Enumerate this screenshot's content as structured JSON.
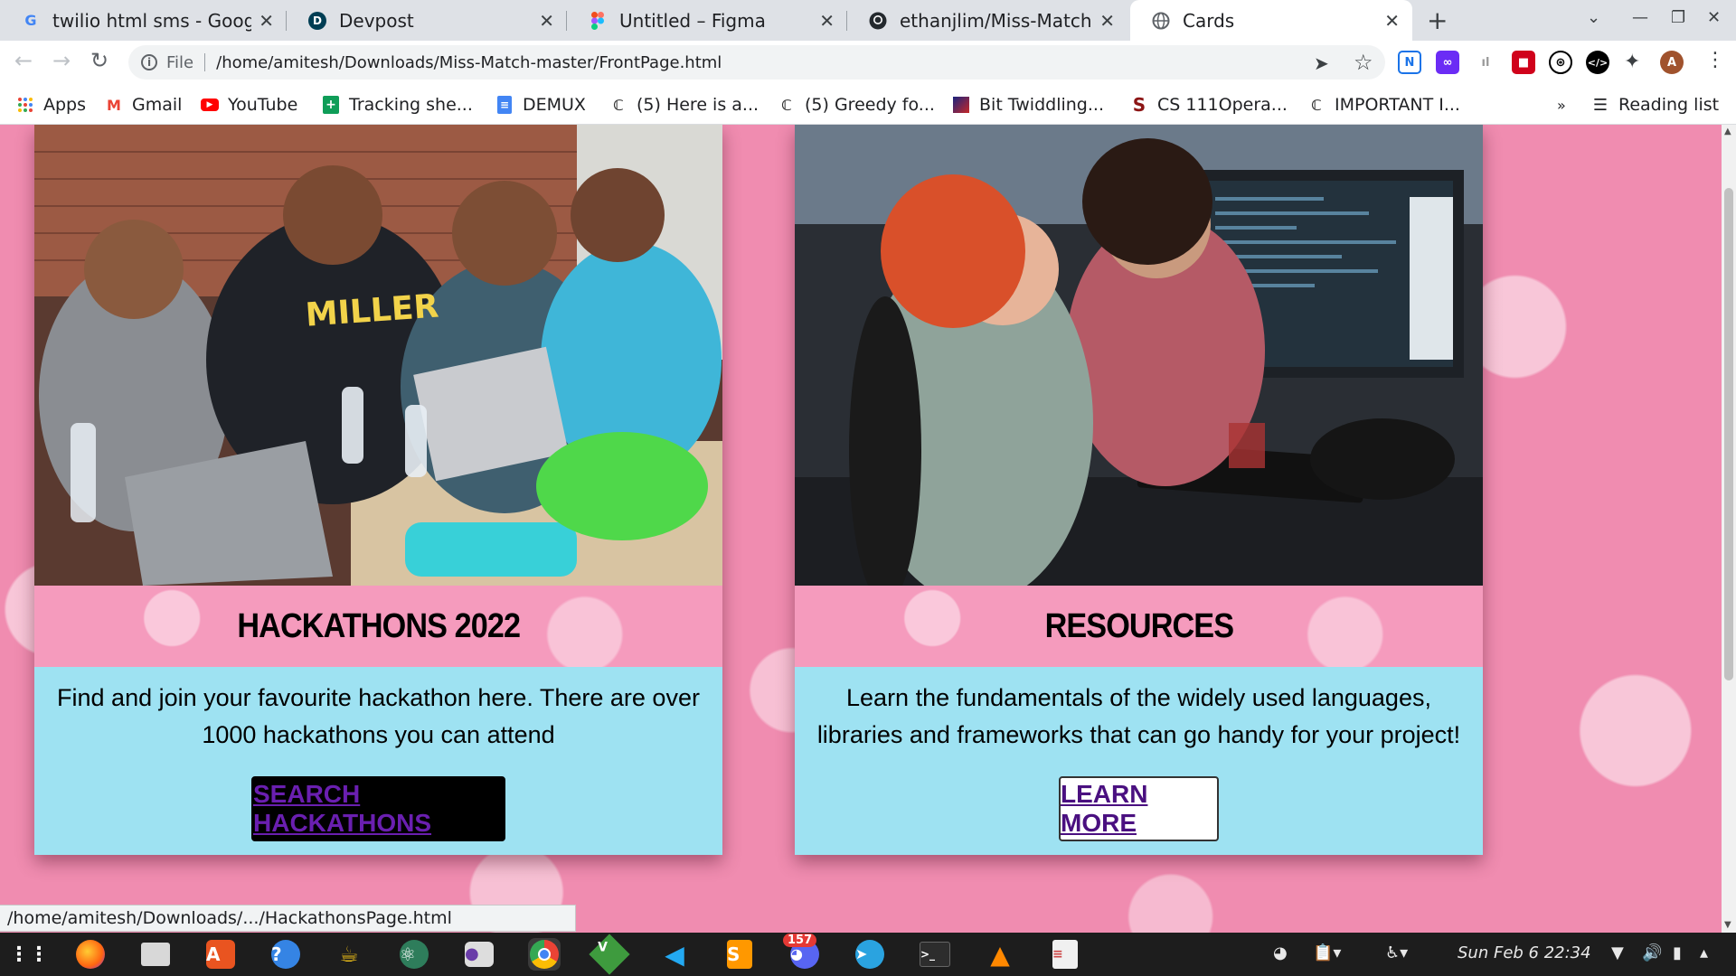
{
  "tabs": [
    {
      "title": "twilio html sms - Google",
      "favicon": "G",
      "color": "#4285f4"
    },
    {
      "title": "Devpost",
      "favicon": "D",
      "color": "#003e54"
    },
    {
      "title": "Untitled – Figma",
      "favicon": "F",
      "color": "#f24e1e"
    },
    {
      "title": "ethanjlim/Miss-Match",
      "favicon": "gh",
      "color": "#24292e"
    },
    {
      "title": "Cards",
      "favicon": "globe",
      "color": "#5f6368"
    }
  ],
  "address": {
    "scheme": "File",
    "url": "/home/amitesh/Downloads/Miss-Match-master/FrontPage.html"
  },
  "bookmarks": [
    {
      "label": "Apps"
    },
    {
      "label": "Gmail"
    },
    {
      "label": "YouTube"
    },
    {
      "label": "Tracking she..."
    },
    {
      "label": "DEMUX"
    },
    {
      "label": "(5) Here is a..."
    },
    {
      "label": "(5) Greedy fo..."
    },
    {
      "label": "Bit Twiddling..."
    },
    {
      "label": "CS 111Opera..."
    },
    {
      "label": "IMPORTANT I..."
    }
  ],
  "bookmarks_overflow": "»",
  "reading_list": "Reading list",
  "cards": [
    {
      "title": "HACKATHONS 2022",
      "description": "Find and join your favourite hackathon here. There are over 1000 hackathons you can attend",
      "button": "SEARCH HACKATHONS"
    },
    {
      "title": "RESOURCES",
      "description": "Learn the fundamentals of the widely used languages, libraries and frameworks that can go handy for your project!",
      "button": "LEARN MORE"
    }
  ],
  "status_url": "/home/amitesh/Downloads/.../HackathonsPage.html",
  "taskbar": {
    "discord_badge": "157",
    "clock": "Sun Feb 6  22:34"
  }
}
